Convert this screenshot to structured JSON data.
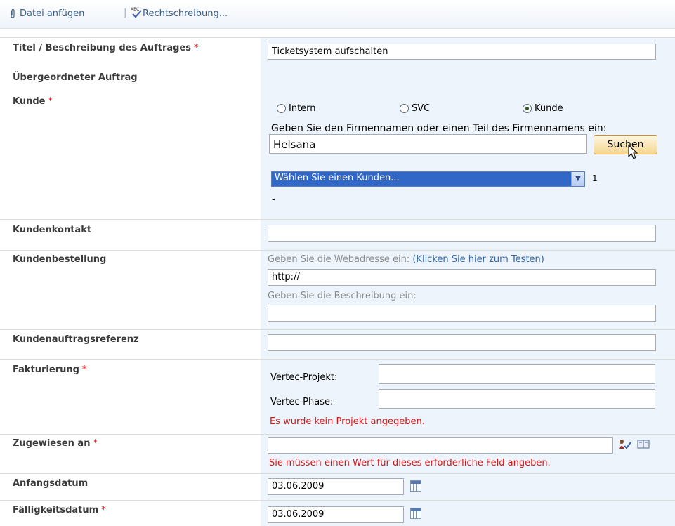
{
  "toolbar": {
    "attach_label": "Datei anfügen",
    "separator": "|",
    "spellcheck_label": "Rechtschreibung..."
  },
  "fields": {
    "title": {
      "label": "Titel / Beschreibung des Auftrages",
      "required": "*",
      "value": "Ticketsystem aufschalten"
    },
    "parent": {
      "label": "Übergeordneter Auftrag"
    },
    "customer": {
      "label": "Kunde",
      "required": "*",
      "radio_options": [
        "Intern",
        "SVC",
        "Kunde"
      ],
      "selected": "Kunde",
      "prompt": "Geben Sie den Firmennamen oder einen Teil des Firmennamens ein:",
      "search_value": "Helsana",
      "search_button": "Suchen",
      "select_value": "Wählen Sie einen Kunden...",
      "result_count": "1",
      "dash": "-"
    },
    "contact": {
      "label": "Kundenkontakt",
      "value": ""
    },
    "order": {
      "label": "Kundenbestellung",
      "url_hint": "Geben Sie die Webadresse ein:",
      "url_test_link": "(Klicken Sie hier zum Testen)",
      "url_value": "http://",
      "desc_hint": "Geben Sie die Beschreibung ein:",
      "desc_value": ""
    },
    "reference": {
      "label": "Kundenauftragsreferenz",
      "value": ""
    },
    "billing": {
      "label": "Fakturierung",
      "required": "*",
      "project_label": "Vertec-Projekt:",
      "project_value": "",
      "phase_label": "Vertec-Phase:",
      "phase_value": "",
      "error": "Es wurde kein Projekt angegeben."
    },
    "assigned": {
      "label": "Zugewiesen an",
      "required": "*",
      "value": "",
      "error": "Sie müssen einen Wert für dieses erforderliche Feld angeben."
    },
    "start_date": {
      "label": "Anfangsdatum",
      "value": "03.06.2009"
    },
    "due_date": {
      "label": "Fälligkeitsdatum",
      "required": "*",
      "value": "03.06.2009"
    }
  }
}
